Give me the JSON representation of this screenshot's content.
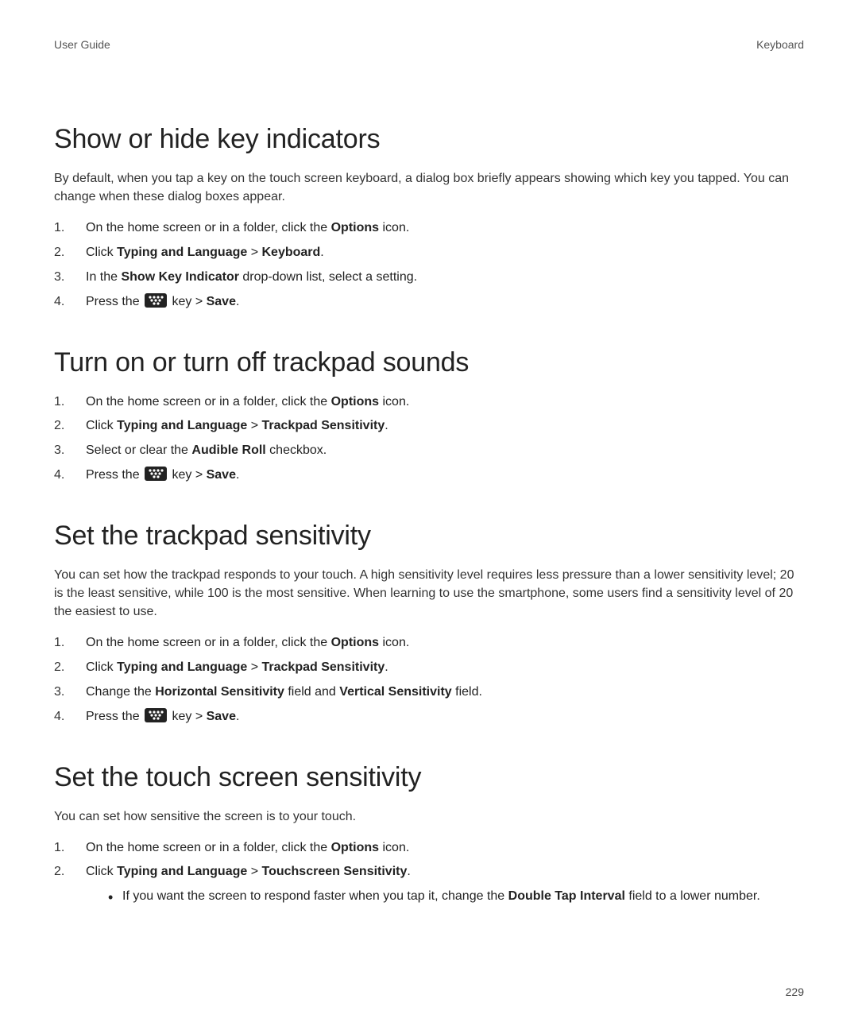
{
  "header": {
    "left": "User Guide",
    "right": "Keyboard"
  },
  "page_number": "229",
  "common": {
    "step_options_pre": "On the home screen or in a folder, click the ",
    "step_options_bold": "Options",
    "step_options_post": " icon.",
    "click": "Click ",
    "typing_lang": "Typing and Language",
    "sep": " > ",
    "press_the": "Press the ",
    "key_sep": " key > ",
    "save": "Save",
    "period": "."
  },
  "s1": {
    "title": "Show or hide key indicators",
    "intro": "By default, when you tap a key on the touch screen keyboard, a dialog box briefly appears showing which key you tapped. You can change when these dialog boxes appear.",
    "target": "Keyboard",
    "step3_pre": "In the ",
    "step3_bold": "Show Key Indicator",
    "step3_post": " drop-down list, select a setting."
  },
  "s2": {
    "title": "Turn on or turn off trackpad sounds",
    "target": "Trackpad Sensitivity",
    "step3_pre": "Select or clear the ",
    "step3_bold": "Audible Roll",
    "step3_post": " checkbox."
  },
  "s3": {
    "title": "Set the trackpad sensitivity",
    "intro": "You can set how the trackpad responds to your touch. A high sensitivity level requires less pressure than a lower sensitivity level; 20 is the least sensitive, while 100 is the most sensitive. When learning to use the smartphone, some users find a sensitivity level of 20 the easiest to use.",
    "target": "Trackpad Sensitivity",
    "step3_pre": "Change the ",
    "step3_b1": "Horizontal Sensitivity",
    "step3_mid": " field and ",
    "step3_b2": "Vertical Sensitivity",
    "step3_post": " field."
  },
  "s4": {
    "title": "Set the touch screen sensitivity",
    "intro": "You can set how sensitive the screen is to your touch.",
    "target": "Touchscreen Sensitivity",
    "bullet_pre": "If you want the screen to respond faster when you tap it, change the ",
    "bullet_bold": "Double Tap Interval",
    "bullet_post": " field to a lower number."
  }
}
